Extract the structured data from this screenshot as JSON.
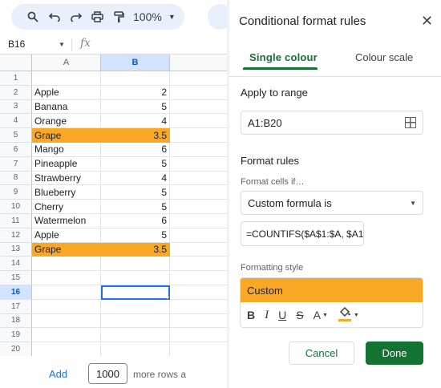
{
  "sheet": {
    "toolbar": {
      "icons": [
        "search-icon",
        "undo-icon",
        "redo-icon",
        "print-icon",
        "paint-format-icon"
      ],
      "zoom": "100%"
    },
    "name_box": "B16",
    "fx_label": "fx",
    "columns": [
      "A",
      "B"
    ],
    "rows": [
      {
        "n": "1",
        "a": "",
        "b": "",
        "highlight": false
      },
      {
        "n": "2",
        "a": "Apple",
        "b": "2",
        "highlight": false
      },
      {
        "n": "3",
        "a": "Banana",
        "b": "5",
        "highlight": false
      },
      {
        "n": "4",
        "a": "Orange",
        "b": "4",
        "highlight": false
      },
      {
        "n": "5",
        "a": "Grape",
        "b": "3.5",
        "highlight": true
      },
      {
        "n": "6",
        "a": "Mango",
        "b": "6",
        "highlight": false
      },
      {
        "n": "7",
        "a": "Pineapple",
        "b": "5",
        "highlight": false
      },
      {
        "n": "8",
        "a": "Strawberry",
        "b": "4",
        "highlight": false
      },
      {
        "n": "9",
        "a": "Blueberry",
        "b": "5",
        "highlight": false
      },
      {
        "n": "10",
        "a": "Cherry",
        "b": "5",
        "highlight": false
      },
      {
        "n": "11",
        "a": "Watermelon",
        "b": "6",
        "highlight": false
      },
      {
        "n": "12",
        "a": "Apple",
        "b": "5",
        "highlight": false
      },
      {
        "n": "13",
        "a": "Grape",
        "b": "3.5",
        "highlight": true
      },
      {
        "n": "14",
        "a": "",
        "b": "",
        "highlight": false
      },
      {
        "n": "15",
        "a": "",
        "b": "",
        "highlight": false
      },
      {
        "n": "16",
        "a": "",
        "b": "",
        "highlight": false,
        "active": true
      },
      {
        "n": "17",
        "a": "",
        "b": "",
        "highlight": false
      },
      {
        "n": "18",
        "a": "",
        "b": "",
        "highlight": false
      },
      {
        "n": "19",
        "a": "",
        "b": "",
        "highlight": false
      },
      {
        "n": "20",
        "a": "",
        "b": "",
        "highlight": false
      }
    ],
    "highlight_color": "#f9a825",
    "footer": {
      "add_label": "Add",
      "rows_value": "1000",
      "more_rows_label": "more rows a"
    }
  },
  "panel": {
    "title": "Conditional format rules",
    "tabs": [
      "Single colour",
      "Colour scale"
    ],
    "apply_range_label": "Apply to range",
    "range_value": "A1:B20",
    "format_rules_label": "Format rules",
    "format_cells_if_label": "Format cells if…",
    "condition": "Custom formula is",
    "formula": "=COUNTIFS($A$1:$A, $A1,",
    "formatting_style_label": "Formatting style",
    "style_preview": "Custom",
    "style_color": "#f9a825",
    "style_tools": {
      "bold": "B",
      "italic": "I",
      "underline": "U",
      "strikethrough": "S",
      "text_color": "A"
    },
    "cancel_label": "Cancel",
    "done_label": "Done",
    "accent_color": "#137333"
  }
}
